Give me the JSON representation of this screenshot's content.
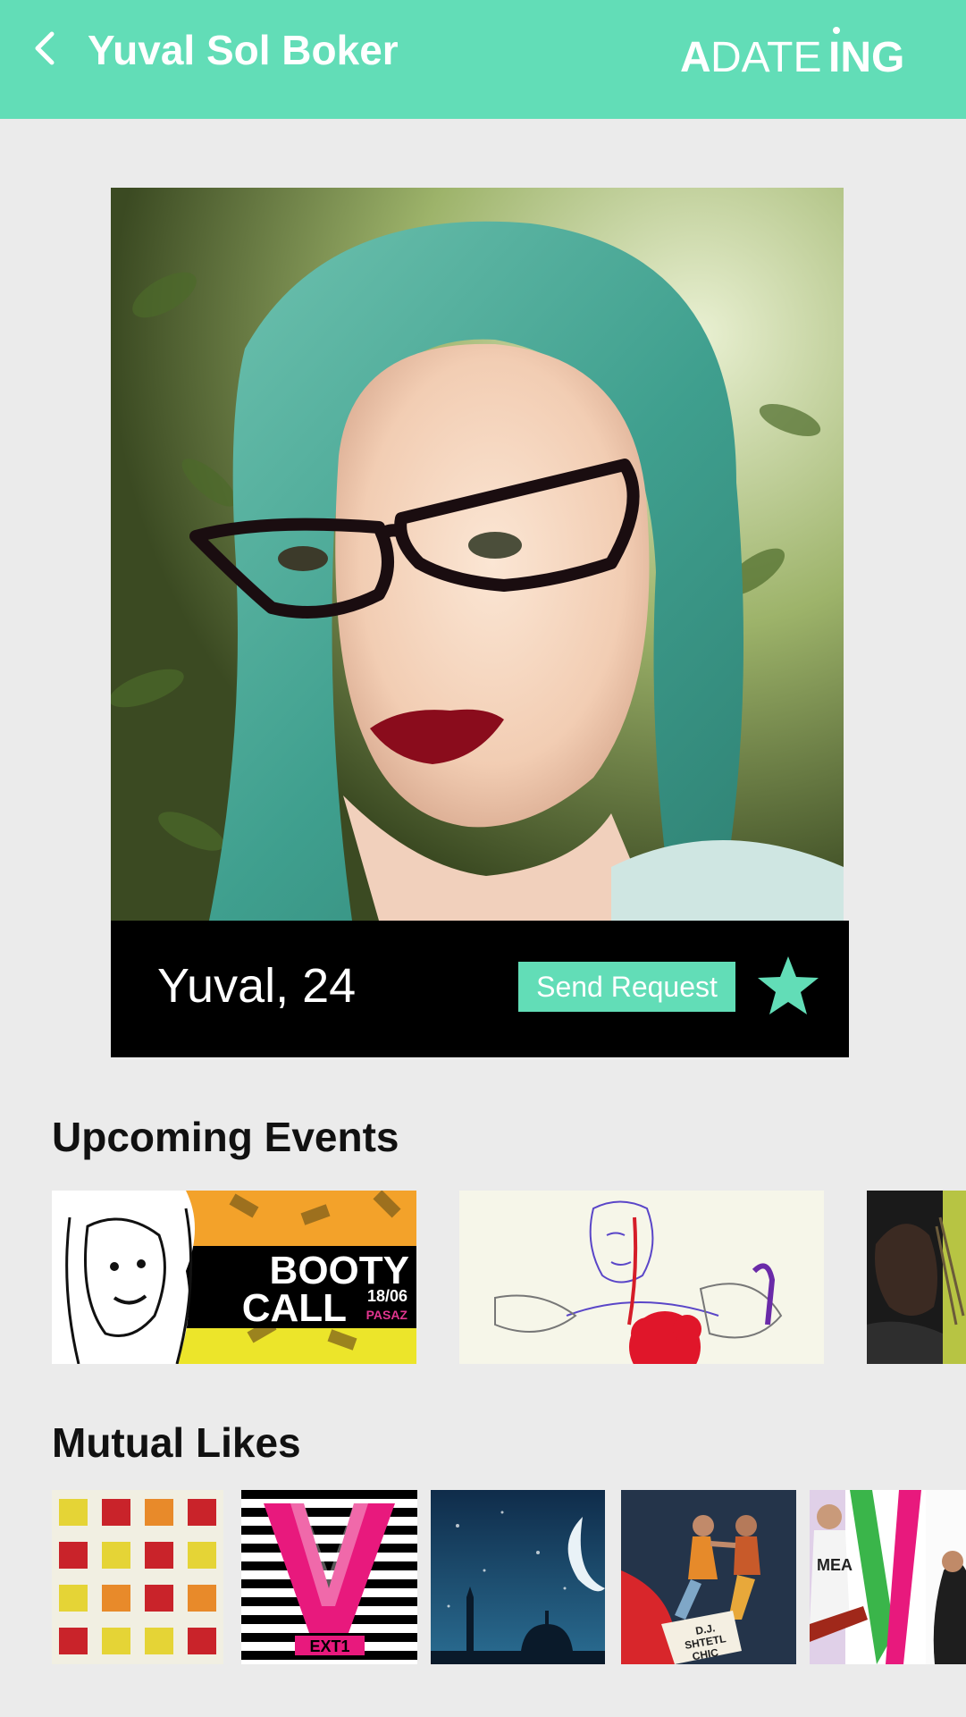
{
  "header": {
    "title": "Yuval Sol Boker",
    "brand_left": "A",
    "brand_mid": "DATE",
    "brand_right": "ING"
  },
  "profile": {
    "name_age": "Yuval, 24",
    "send_request_label": "Send Request"
  },
  "sections": {
    "upcoming_events_title": "Upcoming Events",
    "mutual_likes_title": "Mutual Likes"
  },
  "events": [
    {
      "line1": "BOOTY",
      "line2": "CALL",
      "date": "18/06",
      "venue": "PASAZ"
    },
    {},
    {}
  ],
  "likes": [
    {},
    {
      "label": "EXT1"
    },
    {},
    {
      "label_line1": "D.J.",
      "label_line2": "SHTETL",
      "label_line3": "CHIC"
    },
    {
      "label": "MEA"
    }
  ],
  "colors": {
    "accent": "#62ddb7",
    "background": "#ebebeb",
    "infobar": "#000000",
    "star": "#62ddb7"
  },
  "icons": {
    "back": "chevron-left-icon",
    "star": "star-icon"
  }
}
